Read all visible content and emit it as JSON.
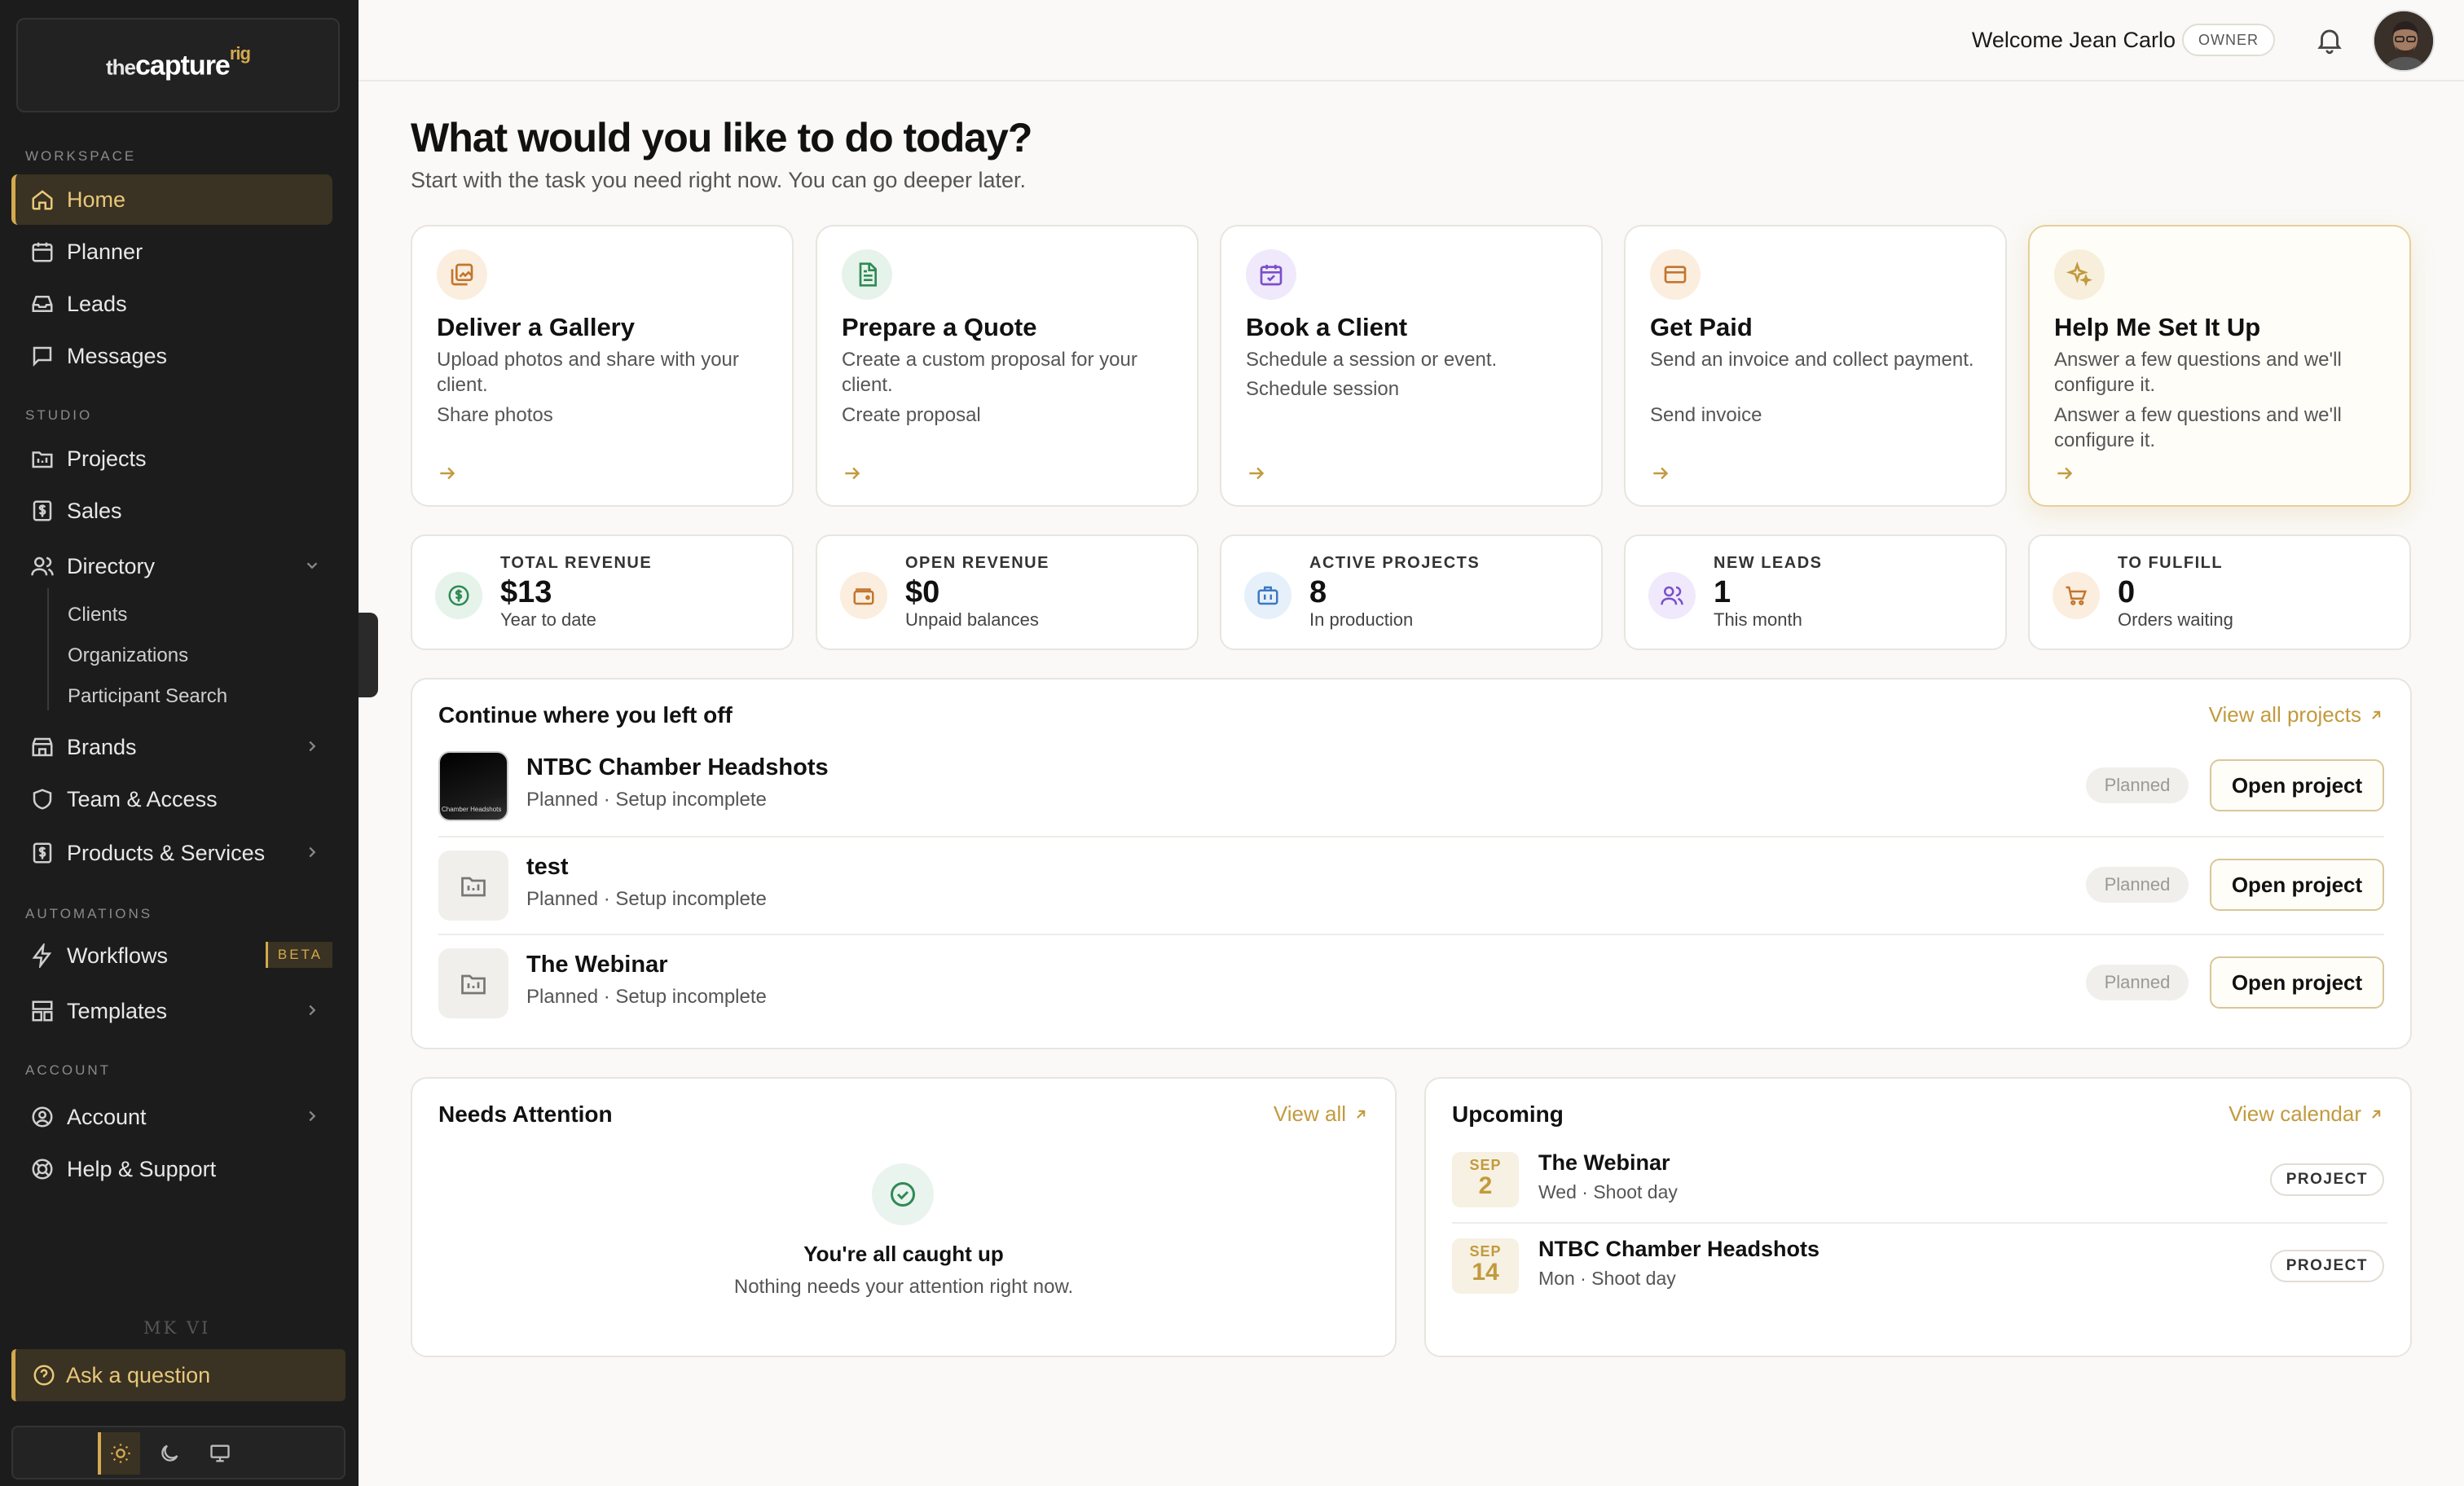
{
  "app": {
    "logo_prefix": "the",
    "logo_main": "capture",
    "logo_suffix": "rig"
  },
  "sidebar": {
    "sections": {
      "workspace": "WORKSPACE",
      "studio": "STUDIO",
      "automations": "AUTOMATIONS",
      "account": "ACCOUNT"
    },
    "items": {
      "home": "Home",
      "planner": "Planner",
      "leads": "Leads",
      "messages": "Messages",
      "projects": "Projects",
      "sales": "Sales",
      "directory": "Directory",
      "clients": "Clients",
      "organizations": "Organizations",
      "participant_search": "Participant Search",
      "brands": "Brands",
      "team_access": "Team & Access",
      "products_services": "Products & Services",
      "workflows": "Workflows",
      "workflows_badge": "BETA",
      "templates": "Templates",
      "account": "Account",
      "help_support": "Help & Support"
    },
    "footer_mark": "MK VI",
    "ask": "Ask a question",
    "accent": "#d4a94f"
  },
  "topbar": {
    "welcome": "Welcome Jean Carlo",
    "role": "OWNER"
  },
  "main": {
    "title": "What would you like to do today?",
    "subtitle": "Start with the task you need right now. You can go deeper later.",
    "actions": [
      {
        "title": "Deliver a Gallery",
        "desc": "Upload photos and share with your client.",
        "sub": "Share photos",
        "icon": "gallery-icon"
      },
      {
        "title": "Prepare a Quote",
        "desc": "Create a custom proposal for your client.",
        "sub": "Create proposal",
        "icon": "document-icon"
      },
      {
        "title": "Book a Client",
        "desc": "Schedule a session or event.",
        "sub": "Schedule session",
        "icon": "calendar-check-icon"
      },
      {
        "title": "Get Paid",
        "desc": "Send an invoice and collect payment.",
        "sub": "Send invoice",
        "icon": "credit-card-icon"
      },
      {
        "title": "Help Me Set It Up",
        "desc": "Answer a few questions and we'll configure it.",
        "sub": "Answer a few questions and we'll configure it.",
        "icon": "sparkle-icon"
      }
    ],
    "stats": [
      {
        "label": "TOTAL REVENUE",
        "value": "$13",
        "sub": "Year to date"
      },
      {
        "label": "OPEN REVENUE",
        "value": "$0",
        "sub": "Unpaid balances"
      },
      {
        "label": "ACTIVE PROJECTS",
        "value": "8",
        "sub": "In production"
      },
      {
        "label": "NEW LEADS",
        "value": "1",
        "sub": "This month"
      },
      {
        "label": "TO FULFILL",
        "value": "0",
        "sub": "Orders waiting"
      }
    ],
    "continue": {
      "title": "Continue where you left off",
      "link": "View all projects",
      "rows": [
        {
          "name": "NTBC Chamber Headshots",
          "meta": "Planned · Setup incomplete",
          "status": "Planned",
          "action": "Open project",
          "thumb_text": "Chamber Headshots"
        },
        {
          "name": "test",
          "meta": "Planned · Setup incomplete",
          "status": "Planned",
          "action": "Open project"
        },
        {
          "name": "The Webinar",
          "meta": "Planned · Setup incomplete",
          "status": "Planned",
          "action": "Open project"
        }
      ]
    },
    "attention": {
      "title": "Needs Attention",
      "link": "View all",
      "empty_title": "You're all caught up",
      "empty_sub": "Nothing needs your attention right now."
    },
    "upcoming": {
      "title": "Upcoming",
      "link": "View calendar",
      "events": [
        {
          "month": "SEP",
          "day": "2",
          "name": "The Webinar",
          "meta": "Wed · Shoot day",
          "tag": "PROJECT"
        },
        {
          "month": "SEP",
          "day": "14",
          "name": "NTBC Chamber Headshots",
          "meta": "Mon · Shoot day",
          "tag": "PROJECT"
        }
      ]
    }
  }
}
